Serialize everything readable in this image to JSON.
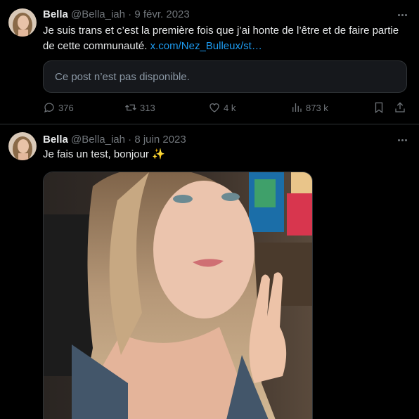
{
  "tweets": [
    {
      "name": "Bella",
      "handle": "@Bella_iah",
      "dot": "·",
      "date": "9 févr. 2023",
      "text": "Je suis trans et c’est la première fois que j’ai honte de l’être et de faire partie de cette communauté.",
      "link": "x.com/Nez_Bulleux/st…",
      "quoted_unavailable": "Ce post n’est pas disponible.",
      "stats": {
        "replies": "376",
        "reposts": "313",
        "likes": "4 k",
        "views": "873 k"
      }
    },
    {
      "name": "Bella",
      "handle": "@Bella_iah",
      "dot": "·",
      "date": "8 juin 2023",
      "text": "Je fais un test, bonjour ✨"
    }
  ],
  "colors": {
    "background": "#000000",
    "text": "#e7e9ea",
    "muted": "#71767b",
    "link": "#1d9bf0",
    "border": "#2f3336"
  },
  "icons": [
    "more-icon",
    "reply-icon",
    "repost-icon",
    "like-icon",
    "views-icon",
    "bookmark-icon",
    "share-icon"
  ]
}
